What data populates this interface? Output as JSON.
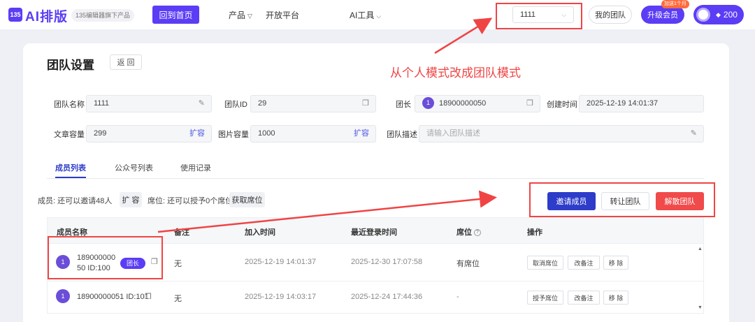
{
  "nav": {
    "logo_mark": "135",
    "brand": "AI排版",
    "tagline": "135编辑器旗下产品",
    "home_label": "回到首页",
    "items": [
      {
        "label": "产品",
        "has_chevron": true
      },
      {
        "label": "开放平台",
        "has_chevron": false
      },
      {
        "label": "AI工具",
        "has_chevron": true
      }
    ],
    "team_select_value": "1111",
    "my_team_label": "我的团队",
    "upgrade_label": "升级会员",
    "bonus_badge": "加送1个月",
    "credits": "200"
  },
  "annotation": "从个人模式改成团队模式",
  "page": {
    "title": "团队设置",
    "back_label": "返 回"
  },
  "fields": {
    "team_name_label": "团队名称",
    "team_name": "1111",
    "team_id_label": "团队ID",
    "team_id": "29",
    "leader_label": "团长",
    "leader_avatar": "1",
    "leader": "18900000050",
    "created_label": "创建时间",
    "created": "2025-12-19 14:01:37",
    "article_cap_label": "文章容量",
    "article_cap": "299",
    "image_cap_label": "图片容量",
    "image_cap": "1000",
    "expand_label": "扩容",
    "desc_label": "团队描述",
    "desc_placeholder": "请输入团队描述"
  },
  "tabs": [
    {
      "label": "成员列表",
      "active": true
    },
    {
      "label": "公众号列表",
      "active": false
    },
    {
      "label": "使用记录",
      "active": false
    }
  ],
  "stats": {
    "members_text": "成员: 还可以邀请48人",
    "expand_btn": "扩 容",
    "seats_text": "席位: 还可以授予0个席位",
    "get_seats_btn": "获取席位"
  },
  "actions": {
    "invite": "邀请成员",
    "transfer": "转让团队",
    "dissolve": "解散团队"
  },
  "table": {
    "headers": [
      "成员名称",
      "备注",
      "加入时间",
      "最近登录时间",
      "席位",
      "操作"
    ],
    "rows": [
      {
        "avatar": "1",
        "name_line1": "189000000",
        "name_line2": "50 ID:100",
        "tag": "团长",
        "note": "无",
        "joined": "2025-12-19 14:01:37",
        "last_login": "2025-12-30 17:07:58",
        "seat": "有席位",
        "ops": [
          "取消席位",
          "改备注",
          "移 除"
        ]
      },
      {
        "avatar": "1",
        "name": "18900000051 ID:101",
        "note": "无",
        "joined": "2025-12-19 14:03:17",
        "last_login": "2025-12-24 17:44:36",
        "seat": "-",
        "ops": [
          "授予席位",
          "改备注",
          "移 除"
        ]
      }
    ]
  },
  "colors": {
    "brand": "#5b3df5",
    "primary": "#2d3cc9",
    "danger": "#f04a4a",
    "annotation": "#f04444"
  }
}
